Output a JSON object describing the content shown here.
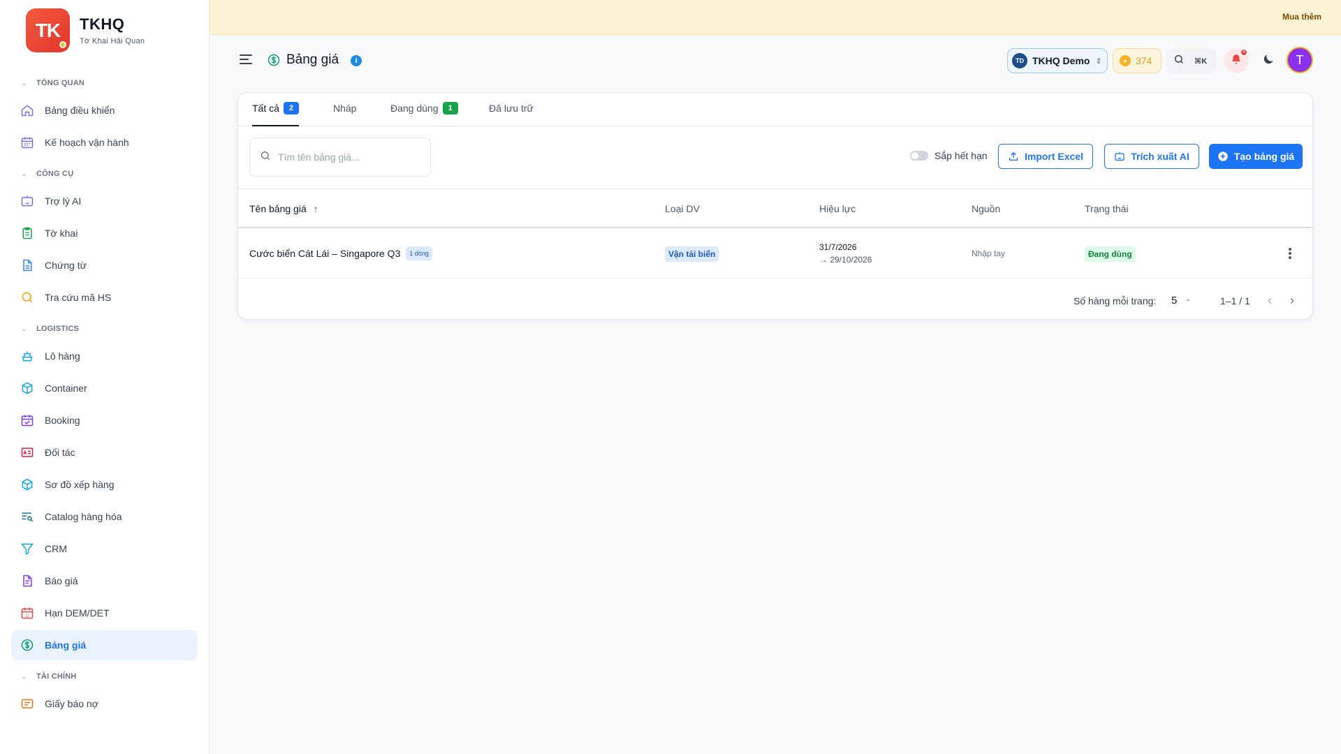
{
  "brand": {
    "logo_text": "TK",
    "title": "TKHQ",
    "subtitle": "Tờ Khai Hải Quan"
  },
  "banner": {
    "buy_more": "Mua thêm"
  },
  "sidebar": {
    "sections": [
      {
        "label": "TỔNG QUAN",
        "items": [
          {
            "label": "Bảng điều khiển",
            "icon": "home-icon"
          },
          {
            "label": "Kế hoạch vận hành",
            "icon": "calendar-icon"
          }
        ]
      },
      {
        "label": "CÔNG CỤ",
        "items": [
          {
            "label": "Trợ lý AI",
            "icon": "robot-icon"
          },
          {
            "label": "Tờ khai",
            "icon": "clipboard-icon"
          },
          {
            "label": "Chứng từ",
            "icon": "document-icon"
          },
          {
            "label": "Tra cứu mã HS",
            "icon": "search-icon"
          }
        ]
      },
      {
        "label": "LOGISTICS",
        "items": [
          {
            "label": "Lô hàng",
            "icon": "ship-icon"
          },
          {
            "label": "Container",
            "icon": "box-icon"
          },
          {
            "label": "Booking",
            "icon": "calendar-check-icon"
          },
          {
            "label": "Đối tác",
            "icon": "id-card-icon"
          },
          {
            "label": "Sơ đồ xếp hàng",
            "icon": "cube-icon"
          },
          {
            "label": "Catalog hàng hóa",
            "icon": "list-search-icon"
          },
          {
            "label": "CRM",
            "icon": "funnel-icon"
          },
          {
            "label": "Báo giá",
            "icon": "quote-icon"
          },
          {
            "label": "Hạn DEM/DET",
            "icon": "calendar-12-icon",
            "badge": "12"
          },
          {
            "label": "Bảng giá",
            "icon": "dollar-circle-icon",
            "active": true
          }
        ]
      },
      {
        "label": "TÀI CHÍNH",
        "items": [
          {
            "label": "Giấy báo nợ",
            "icon": "receipt-icon"
          }
        ]
      }
    ]
  },
  "header": {
    "title": "Bảng giá",
    "org": {
      "initials": "TD",
      "name": "TKHQ Demo"
    },
    "coins": "374",
    "shortcut": "⌘K",
    "notifications": "4",
    "user_initial": "T"
  },
  "tabs": [
    {
      "label": "Tất cả",
      "count": "2",
      "active": true
    },
    {
      "label": "Nháp"
    },
    {
      "label": "Đang dùng",
      "count": "1"
    },
    {
      "label": "Đã lưu trữ"
    }
  ],
  "toolbar": {
    "search_placeholder": "Tìm tên bảng giá...",
    "toggle_label": "Sắp hết hạn",
    "import_label": "Import Excel",
    "extract_label": "Trích xuất AI",
    "create_label": "Tạo bảng giá"
  },
  "table": {
    "columns": [
      "Tên bảng giá",
      "Loại DV",
      "Hiệu lực",
      "Nguồn",
      "Trạng thái"
    ],
    "sort_indicator": "↑",
    "rows": [
      {
        "name": "Cước biển Cát Lái – Singapore Q3",
        "lines": "1 dòng",
        "service": "Vận tải biển",
        "valid_from": "31/7/2026",
        "valid_to": "→ 29/10/2026",
        "source": "Nhập tay",
        "status": "Đang dùng"
      }
    ]
  },
  "pagination": {
    "rows_label": "Số hàng mỗi trang:",
    "rows_value": "5",
    "range": "1–1 / 1"
  },
  "colors": {
    "primary": "#1d74f5",
    "success": "#16a34a",
    "banner": "#fdf3d4",
    "logo": "#e3342f"
  }
}
